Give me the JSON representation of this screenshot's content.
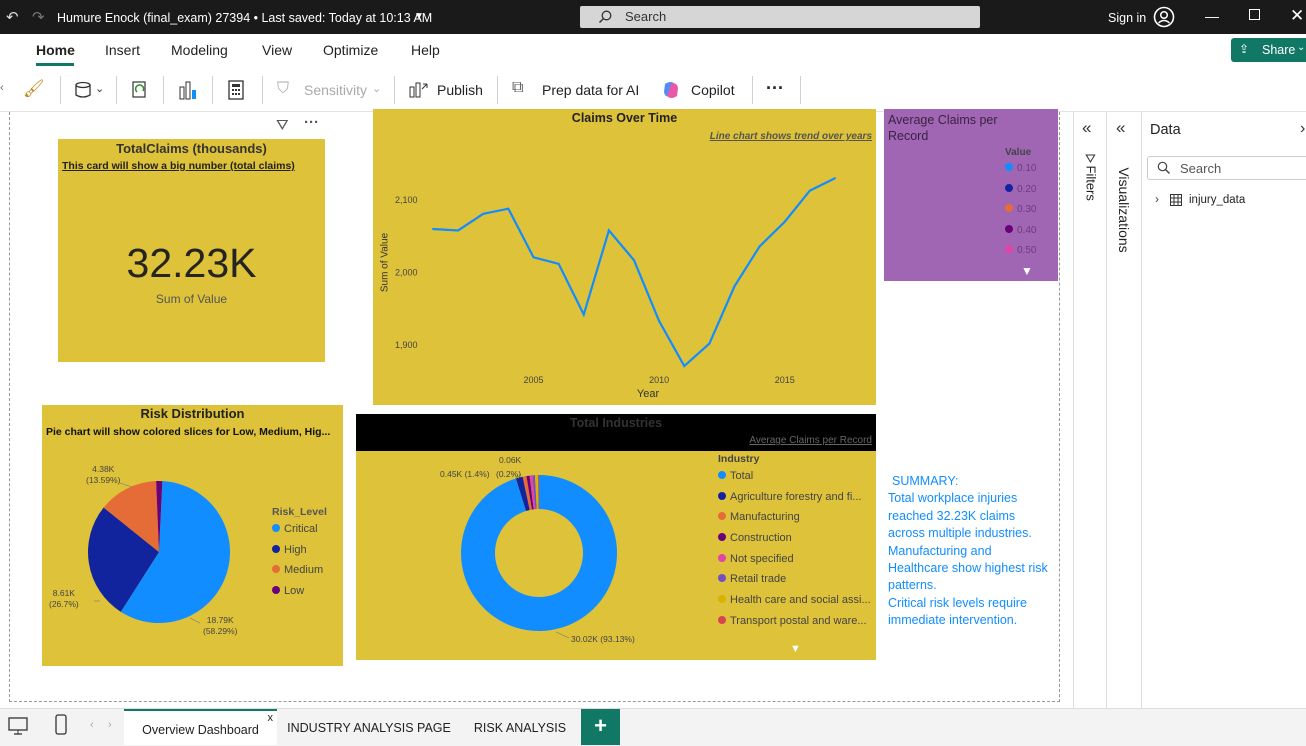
{
  "titlebar": {
    "title": "Humure Enock (final_exam) 27394 • Last saved: Today at 10:13 AM",
    "search": "Search",
    "signin": "Sign in"
  },
  "menu": {
    "items": [
      "Home",
      "Insert",
      "Modeling",
      "View",
      "Optimize",
      "Help"
    ],
    "share": "Share"
  },
  "ribbon": {
    "sensitivity": "Sensitivity",
    "publish": "Publish",
    "prep_ai": "Prep data for AI",
    "copilot": "Copilot",
    "more": "···"
  },
  "card": {
    "title": "TotalClaims (thousands)",
    "note": "This card will show a big number (total claims)",
    "value": "32.23K",
    "caption": "Sum of Value"
  },
  "line_chart": {
    "title": "Claims Over Time",
    "note": "Line chart shows trend over years",
    "ylabel": "Sum of Value",
    "xlabel": "Year"
  },
  "avg_card": {
    "title": "Average Claims per Record",
    "legend_title": "Value",
    "items": [
      "0.10",
      "0.20",
      "0.30",
      "0.40",
      "0.50"
    ],
    "colors": [
      "#118dff",
      "#12239e",
      "#e66c37",
      "#6b007b",
      "#e044a7"
    ]
  },
  "pie": {
    "title": "Risk Distribution",
    "note": "Pie chart will show colored slices for Low, Medium, Hig...",
    "legend_title": "Risk_Level",
    "legend": [
      "Critical",
      "High",
      "Medium",
      "Low"
    ],
    "labels": {
      "critical_value": "18.79K",
      "critical_pct": "(58.29%)",
      "high_value": "8.61K",
      "high_pct": "(26.7%)",
      "medium_value": "4.38K",
      "medium_pct": "(13.59%)"
    }
  },
  "donut": {
    "title": "Total Industries",
    "note": "Average Claims per Record",
    "legend_title": "Industry",
    "legend": [
      "Total",
      "Agriculture forestry and fi...",
      "Manufacturing",
      "Construction",
      "Not specified",
      "Retail trade",
      "Health care and social assi...",
      "Transport postal and ware..."
    ],
    "labels": {
      "main": "30.02K (93.13%)",
      "small1": "0.45K (1.4%)",
      "small2": "(0.2%)",
      "small3": "0.06K"
    }
  },
  "summary": {
    "lines": [
      "SUMMARY:",
      "Total workplace injuries",
      "reached 32.23K claims",
      "across multiple industries.",
      "Manufacturing and",
      "Healthcare show highest risk",
      "patterns.",
      "Critical risk levels require",
      "immediate intervention."
    ]
  },
  "panes": {
    "filters": "Filters",
    "visualizations": "Visualizations",
    "data": "Data",
    "search": "Search",
    "table": "injury_data"
  },
  "tabs": [
    "Overview Dashboard",
    "INDUSTRY ANALYSIS PAGE",
    "RISK ANALYSIS"
  ],
  "colors": {
    "tile": "#ddc23a",
    "purple": "#a066b4",
    "pbi_blue": "#118dff",
    "navy": "#12239e",
    "orange": "#e66c37",
    "violet": "#6b007b",
    "pink": "#e044a7",
    "purple2": "#744ec2",
    "gold": "#d9b300",
    "red": "#d64550",
    "accent_green": "#117865"
  },
  "chart_data": [
    {
      "type": "line",
      "title": "Claims Over Time",
      "xlabel": "Year",
      "ylabel": "Sum of Value",
      "x": [
        2001,
        2002,
        2003,
        2004,
        2005,
        2006,
        2007,
        2008,
        2009,
        2010,
        2011,
        2012,
        2013,
        2014,
        2015,
        2016,
        2017
      ],
      "y": [
        2060,
        2058,
        2081,
        2088,
        2021,
        2012,
        1942,
        2058,
        2017,
        1933,
        1871,
        1902,
        1981,
        2036,
        2070,
        2113,
        2130
      ],
      "ylim": [
        1860,
        2140
      ],
      "yticks": [
        1900,
        2000,
        2100
      ],
      "xticks": [
        2005,
        2010,
        2015
      ]
    },
    {
      "type": "pie",
      "title": "Risk Distribution",
      "categories": [
        "Critical",
        "High",
        "Medium",
        "Low"
      ],
      "values": [
        18.79,
        8.61,
        4.38,
        0.45
      ],
      "percents": [
        58.29,
        26.7,
        13.59,
        1.4
      ]
    },
    {
      "type": "pie",
      "title": "Total Industries",
      "categories": [
        "Total",
        "Agriculture forestry and fi...",
        "Manufacturing",
        "Construction",
        "Not specified",
        "Retail trade",
        "Health care and social assi...",
        "Transport postal and ware..."
      ],
      "values": [
        30.02,
        0.45,
        0.25,
        0.2,
        0.2,
        0.15,
        0.2,
        0.06
      ],
      "percents": [
        93.13,
        1.4,
        0.8,
        0.6,
        0.6,
        0.5,
        0.6,
        0.2
      ]
    }
  ]
}
